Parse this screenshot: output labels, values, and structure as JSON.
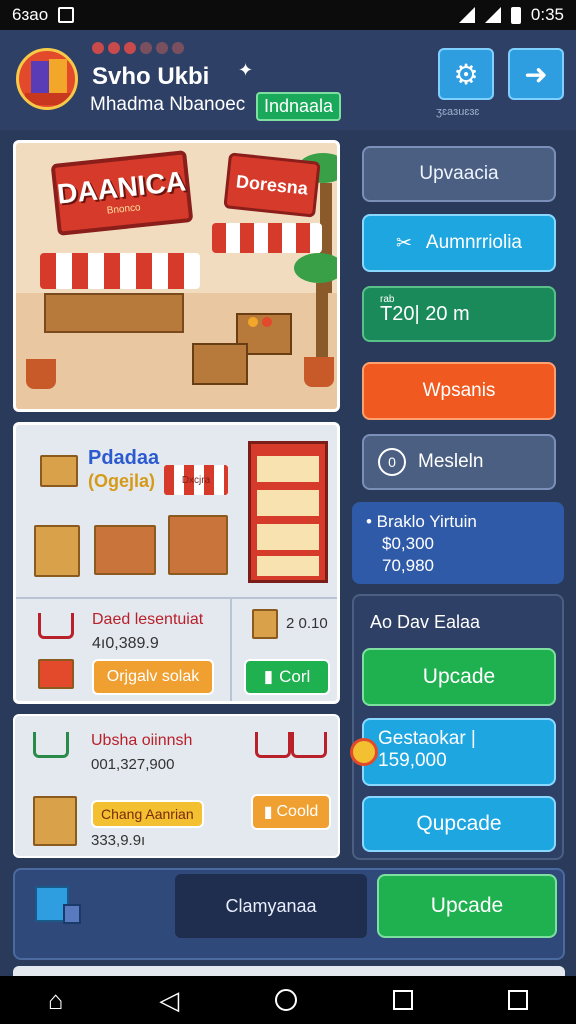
{
  "status_bar": {
    "left_text": "6ɜao",
    "time": "0:35"
  },
  "header": {
    "player_name": "Svho Ukbi",
    "player_sub": "Mhadma Nbanoec",
    "region_badge": "Indnaala",
    "settings_caption": "ʒɛaɜuɛɜɛ",
    "star_icon": "✦",
    "settings_icon": "⚙",
    "arrow_icon": "➜"
  },
  "shop_scene": {
    "sign_main_title": "DAANICA",
    "sign_main_sub": "Bnonco",
    "sign_side_title": "Doresna"
  },
  "market_panel": {
    "logo_line1": "Pdadaa",
    "logo_line2": "(Ogejla)",
    "stall_label": "Dxcjra",
    "title": "Daed lesentuiat",
    "value": "4ı0,389.9",
    "orange_button": "Orjgalv solak",
    "count": "2  0.10",
    "green_button": "Corl"
  },
  "cart_panel": {
    "title": "Ubsha oiinnsh",
    "value": "001,327,900",
    "badge": "Chang Aanrian",
    "value2": "333,9.9ı",
    "gold_button": "Coold"
  },
  "right_column": {
    "btn1": "Upvaacia",
    "btn2": "Aumnrriolia",
    "btn3_caption": "rab",
    "btn3": "T20|  20 m",
    "btn4": "Wpsanis",
    "btn5_icon": "0",
    "btn5": "Mesleln",
    "info_line1": "• Braklo Yirtuin",
    "info_line2": "$0,300",
    "info_line3": "70,980"
  },
  "upgrade_panel": {
    "title": "Ao Dav Ealaa",
    "green_button": "Upcade",
    "blue_title": "Gestaokar |",
    "blue_value": "159,000",
    "blue_button": "Qupcade"
  },
  "bottom_panel": {
    "dark_button": "Clamyanaa",
    "green_button": "Upcade"
  },
  "nav": {
    "home": "⌂",
    "back": "◁"
  }
}
